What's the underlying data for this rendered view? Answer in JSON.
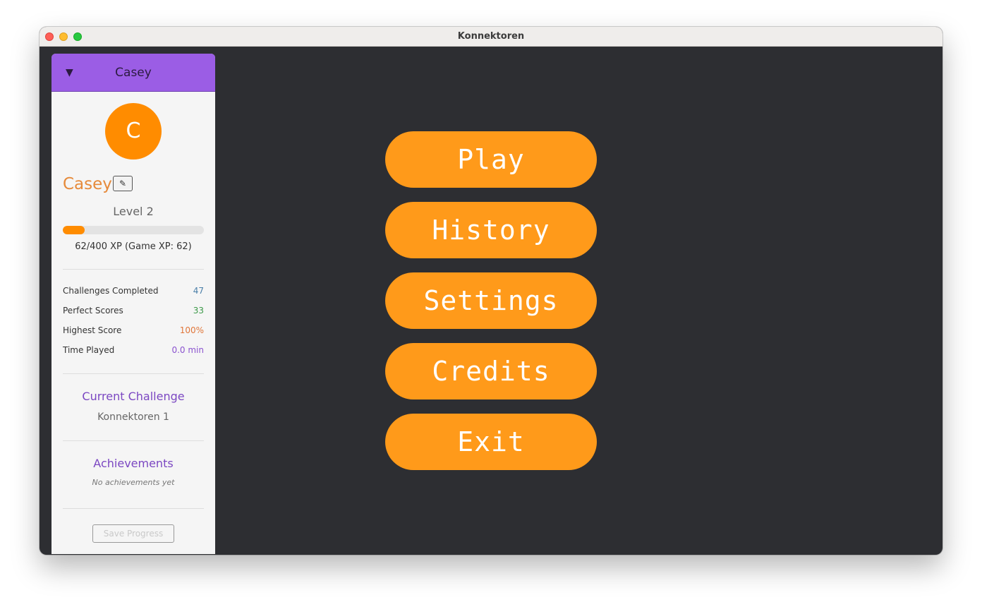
{
  "window": {
    "title": "Konnektoren"
  },
  "sidebar": {
    "toggle_glyph": "▼",
    "header_name": "Casey",
    "avatar_initial": "C",
    "profile_name": "Casey",
    "edit_icon_glyph": "✎",
    "level_text": "Level 2",
    "xp": {
      "current": 62,
      "max": 400,
      "text": "62/400 XP (Game XP: 62)"
    },
    "stats": [
      {
        "label": "Challenges Completed",
        "value": "47",
        "color": "#4a7fa8"
      },
      {
        "label": "Perfect Scores",
        "value": "33",
        "color": "#3d9a4a"
      },
      {
        "label": "Highest Score",
        "value": "100%",
        "color": "#e0763a"
      },
      {
        "label": "Time Played",
        "value": "0.0 min",
        "color": "#8a52cf"
      }
    ],
    "current_challenge": {
      "title": "Current Challenge",
      "value": "Konnektoren 1"
    },
    "achievements": {
      "title": "Achievements",
      "empty_text": "No achievements yet"
    },
    "save_label": "Save Progress"
  },
  "menu": {
    "buttons": [
      {
        "name": "play-button",
        "label": "Play"
      },
      {
        "name": "history-button",
        "label": "History"
      },
      {
        "name": "settings-button",
        "label": "Settings"
      },
      {
        "name": "credits-button",
        "label": "Credits"
      },
      {
        "name": "exit-button",
        "label": "Exit"
      }
    ]
  },
  "colors": {
    "accent_orange": "#ff9a1a",
    "sidebar_header_purple": "#9b5de5",
    "background_dark": "#2d2e32"
  }
}
